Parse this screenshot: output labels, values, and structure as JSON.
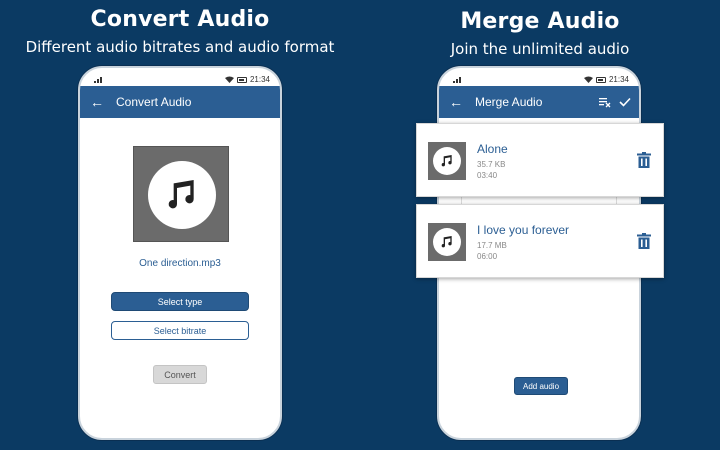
{
  "left_panel": {
    "headline": "Convert Audio",
    "subheadline": "Different audio bitrates and audio format",
    "status_time": "21:34",
    "appbar_title": "Convert Audio",
    "back_icon": "back-arrow-icon",
    "file_name": "One direction.mp3",
    "select_type_label": "Select type",
    "select_bitrate_label": "Select bitrate",
    "convert_label": "Convert"
  },
  "right_panel": {
    "headline": "Merge Audio",
    "subheadline": "Join the unlimited audio",
    "status_time": "21:34",
    "appbar_title": "Merge Audio",
    "items": [
      {
        "name": "Alone",
        "size": "35.7 KB",
        "duration": "03:40"
      },
      {
        "name": "I love you forever",
        "size": "17.7 MB",
        "duration": "06:00"
      }
    ],
    "add_audio_label": "Add audio"
  },
  "colors": {
    "background": "#0b3a63",
    "primary": "#2b5e93",
    "art_gray": "#6b6b6b"
  }
}
